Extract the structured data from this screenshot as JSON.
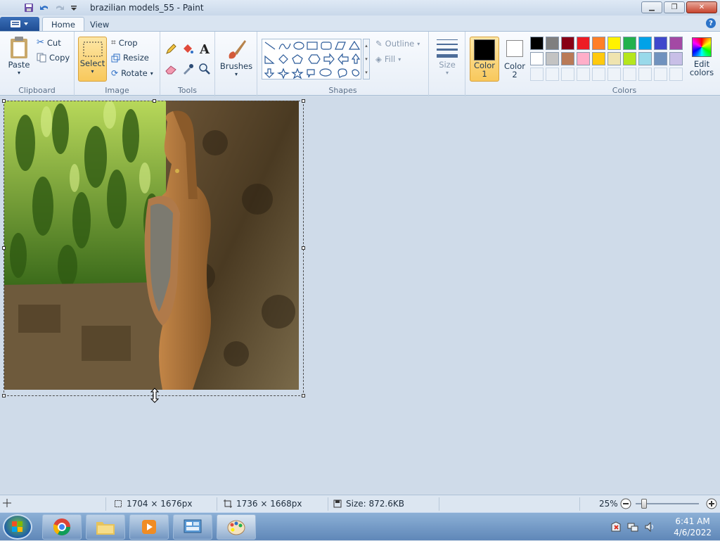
{
  "window": {
    "title": "brazilian models_55 - Paint",
    "minimize": "▁",
    "maximize": "❐",
    "close": "✕"
  },
  "tabs": [
    {
      "label": "Home",
      "active": true
    },
    {
      "label": "View",
      "active": false
    }
  ],
  "help": "?",
  "ribbon": {
    "clipboard": {
      "label": "Clipboard",
      "paste": "Paste",
      "cut": "Cut",
      "copy": "Copy"
    },
    "image": {
      "label": "Image",
      "select": "Select",
      "crop": "Crop",
      "resize": "Resize",
      "rotate": "Rotate"
    },
    "tools": {
      "label": "Tools"
    },
    "brushes": {
      "label": "Brushes"
    },
    "shapes": {
      "label": "Shapes",
      "outline": "Outline",
      "fill": "Fill"
    },
    "size": {
      "label": "Size"
    },
    "color1": {
      "label": "Color",
      "num": "1",
      "value": "#000000"
    },
    "color2": {
      "label": "Color",
      "num": "2",
      "value": "#ffffff"
    },
    "colors": {
      "label": "Colors",
      "edit_line1": "Edit",
      "edit_line2": "colors"
    },
    "palette": [
      "#000000",
      "#7f7f7f",
      "#880015",
      "#ed1c24",
      "#ff7f27",
      "#fff200",
      "#22b14c",
      "#00a2e8",
      "#3f48cc",
      "#a349a4",
      "#ffffff",
      "#c3c3c3",
      "#b97a57",
      "#ffaec9",
      "#ffc90e",
      "#efe4b0",
      "#b5e61d",
      "#99d9ea",
      "#7092be",
      "#c8bfe7"
    ]
  },
  "status": {
    "selection_size": "1704 × 1676px",
    "image_size": "1736 × 1668px",
    "file_size": "Size: 872.6KB",
    "zoom": "25%"
  },
  "taskbar": {
    "time": "6:41 AM",
    "date": "4/6/2022"
  }
}
